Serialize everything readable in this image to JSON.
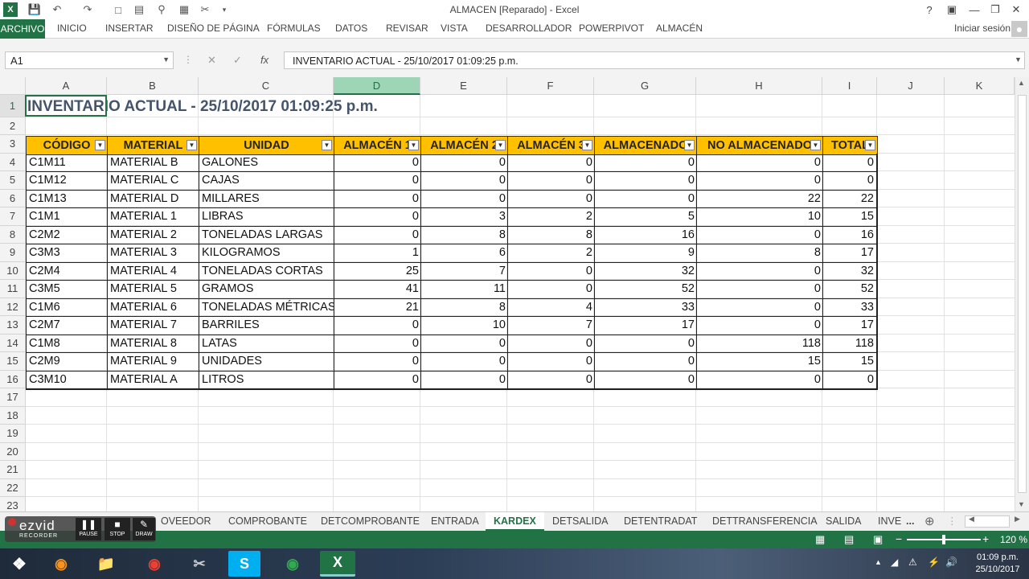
{
  "window": {
    "title": "ALMACEN [Reparado] - Excel",
    "help": "?"
  },
  "ribbon": {
    "tabs": [
      "ARCHIVO",
      "INICIO",
      "INSERTAR",
      "DISEÑO DE PÁGINA",
      "FÓRMULAS",
      "DATOS",
      "REVISAR",
      "VISTA",
      "DESARROLLADOR",
      "POWERPIVOT",
      "ALMACÉN"
    ],
    "signin": "Iniciar sesión"
  },
  "formula_bar": {
    "name_box": "A1",
    "fx": "fx",
    "content": "INVENTARIO ACTUAL - 25/10/2017 01:09:25 p.m."
  },
  "columns": [
    "A",
    "B",
    "C",
    "D",
    "E",
    "F",
    "G",
    "H",
    "I",
    "J",
    "K"
  ],
  "rows": [
    "1",
    "2",
    "3",
    "4",
    "5",
    "6",
    "7",
    "8",
    "9",
    "10",
    "11",
    "12",
    "13",
    "14",
    "15",
    "16",
    "17",
    "18",
    "19",
    "20",
    "21",
    "22",
    "23"
  ],
  "sheet": {
    "title": "INVENTARIO ACTUAL - 25/10/2017 01:09:25 p.m.",
    "headers": [
      "CÓDIGO",
      "MATERIAL",
      "UNIDAD",
      "ALMACÉN 1",
      "ALMACÉN 2",
      "ALMACÉN 3",
      "ALMACENADO",
      "NO ALMACENADO",
      "TOTAL"
    ],
    "data": [
      [
        "C1M11",
        "MATERIAL B",
        "GALONES",
        "0",
        "0",
        "0",
        "0",
        "0",
        "0"
      ],
      [
        "C1M12",
        "MATERIAL C",
        "CAJAS",
        "0",
        "0",
        "0",
        "0",
        "0",
        "0"
      ],
      [
        "C1M13",
        "MATERIAL D",
        "MILLARES",
        "0",
        "0",
        "0",
        "0",
        "22",
        "22"
      ],
      [
        "C1M1",
        "MATERIAL 1",
        "LIBRAS",
        "0",
        "3",
        "2",
        "5",
        "10",
        "15"
      ],
      [
        "C2M2",
        "MATERIAL 2",
        "TONELADAS LARGAS",
        "0",
        "8",
        "8",
        "16",
        "0",
        "16"
      ],
      [
        "C3M3",
        "MATERIAL 3",
        "KILOGRAMOS",
        "1",
        "6",
        "2",
        "9",
        "8",
        "17"
      ],
      [
        "C2M4",
        "MATERIAL 4",
        "TONELADAS CORTAS",
        "25",
        "7",
        "0",
        "32",
        "0",
        "32"
      ],
      [
        "C3M5",
        "MATERIAL 5",
        "GRAMOS",
        "41",
        "11",
        "0",
        "52",
        "0",
        "52"
      ],
      [
        "C1M6",
        "MATERIAL 6",
        "TONELADAS MÉTRICAS",
        "21",
        "8",
        "4",
        "33",
        "0",
        "33"
      ],
      [
        "C2M7",
        "MATERIAL 7",
        "BARRILES",
        "0",
        "10",
        "7",
        "17",
        "0",
        "17"
      ],
      [
        "C1M8",
        "MATERIAL 8",
        "LATAS",
        "0",
        "0",
        "0",
        "0",
        "118",
        "118"
      ],
      [
        "C2M9",
        "MATERIAL 9",
        "UNIDADES",
        "0",
        "0",
        "0",
        "0",
        "15",
        "15"
      ],
      [
        "C3M10",
        "MATERIAL A",
        "LITROS",
        "0",
        "0",
        "0",
        "0",
        "0",
        "0"
      ]
    ]
  },
  "sheet_tabs": {
    "tabs": [
      "OVEEDOR",
      "COMPROBANTE",
      "DETCOMPROBANTE",
      "ENTRADA",
      "KARDEX",
      "DETSALIDA",
      "DETENTRADAT",
      "DETTRANSFERENCIA",
      "SALIDA",
      "INVE"
    ],
    "active": "KARDEX",
    "more": "..."
  },
  "status_bar": {
    "zoom": "120 %"
  },
  "ezvid": {
    "brand": "ezvid",
    "sub": "RECORDER",
    "pause": "PAUSE",
    "stop": "STOP",
    "draw": "DRAW"
  },
  "taskbar": {
    "time": "01:09 p.m.",
    "date": "25/10/2017",
    "excel_label": "X"
  },
  "colors": {
    "excel_green": "#217346",
    "header_fill": "#ffc000",
    "title_text": "#44546a"
  }
}
